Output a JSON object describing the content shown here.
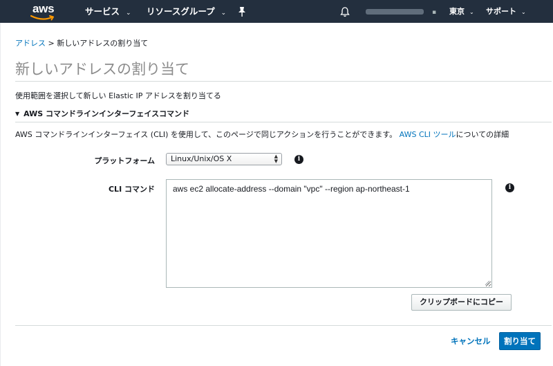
{
  "topnav": {
    "logo_text": "aws",
    "services_label": "サービス",
    "resource_groups_label": "リソースグループ",
    "region_label": "東京",
    "support_label": "サポート",
    "account_separator": "▪",
    "background_color": "#232f3e",
    "logo_smile_color": "#ff9900"
  },
  "breadcrumb": {
    "parent_link": "アドレス",
    "separator": ">",
    "current": "新しいアドレスの割り当て"
  },
  "page": {
    "title": "新しいアドレスの割り当て",
    "description": "使用範囲を選択して新しい Elastic IP アドレスを割り当てる"
  },
  "cli_section": {
    "header": "AWS コマンドラインインターフェイスコマンド",
    "desc_before_link": "AWS コマンドラインインターフェイス (CLI) を使用して、このページで同じアクションを行うことができます。",
    "desc_link": "AWS CLI ツール",
    "desc_after_link": "についての詳細",
    "platform_label": "プラットフォーム",
    "platform_selected": "Linux/Unix/OS X",
    "cli_label": "CLI コマンド",
    "cli_command": "aws ec2 allocate-address --domain \"vpc\" --region ap-northeast-1",
    "copy_button": "クリップボードにコピー"
  },
  "footer": {
    "cancel_label": "キャンセル",
    "assign_label": "割り当て",
    "primary_color": "#0073bb"
  }
}
